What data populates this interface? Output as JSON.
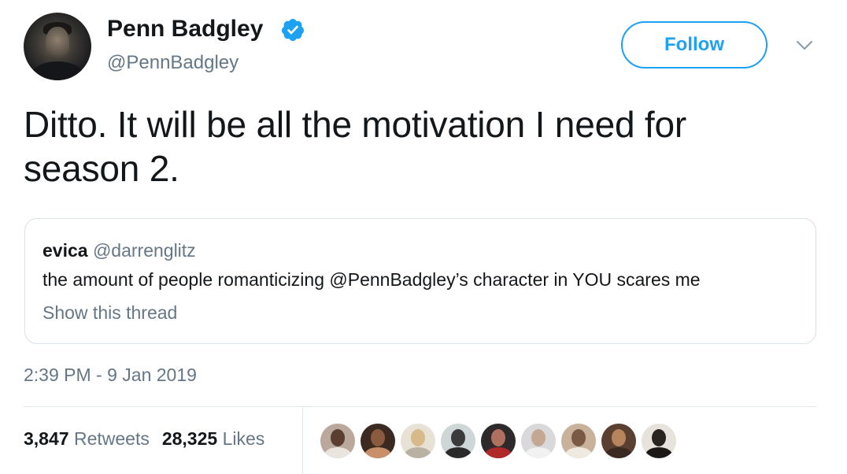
{
  "tweet": {
    "author_name": "Penn Badgley",
    "author_handle": "@PennBadgley",
    "verified": true,
    "follow_label": "Follow",
    "text": "Ditto. It will be all the motivation I need for season 2.",
    "timestamp": "2:39 PM - 9 Jan 2019"
  },
  "quote": {
    "author_name": "evica",
    "author_handle": "@darrenglitz",
    "text": "the amount of people romanticizing @PennBadgley’s character in YOU scares me",
    "show_thread_label": "Show this thread"
  },
  "stats": {
    "retweets_count": "3,847",
    "retweets_label": "Retweets",
    "likes_count": "28,325",
    "likes_label": "Likes"
  },
  "icons": {
    "verified": "verified-badge-icon",
    "menu": "chevron-down-icon"
  },
  "colors": {
    "accent": "#1da1f2",
    "text_primary": "#14171a",
    "text_secondary": "#657786",
    "border": "#e1e8ed"
  },
  "likers": [
    {
      "bg": "#b9a89b",
      "head": "#5a3e2f",
      "body": "#e9e4de"
    },
    {
      "bg": "#3a2a22",
      "head": "#8a5b3e",
      "body": "#c98f6a"
    },
    {
      "bg": "#e8e2d6",
      "head": "#d7b98a",
      "body": "#b9b2a4"
    },
    {
      "bg": "#cfd6d8",
      "head": "#3b3b3b",
      "body": "#2a2a2a"
    },
    {
      "bg": "#2e2a2b",
      "head": "#b07060",
      "body": "#b02a2a"
    },
    {
      "bg": "#d9d9dc",
      "head": "#c4a893",
      "body": "#f1f1f1"
    },
    {
      "bg": "#c9b29c",
      "head": "#7a5a44",
      "body": "#efe9e0"
    },
    {
      "bg": "#5b4032",
      "head": "#b8845e",
      "body": "#3a2a22"
    },
    {
      "bg": "#e7e2dc",
      "head": "#2a2420",
      "body": "#1c1816"
    }
  ]
}
